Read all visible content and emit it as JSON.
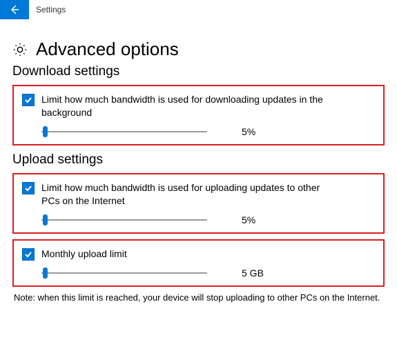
{
  "titlebar": {
    "label": "Settings"
  },
  "page": {
    "title": "Advanced options"
  },
  "download": {
    "section_title": "Download settings",
    "limit_label": "Limit how much bandwidth is used for downloading updates in the background",
    "limit_checked": true,
    "slider_value": "5%"
  },
  "upload": {
    "section_title": "Upload settings",
    "limit_label": "Limit how much bandwidth is used for uploading updates to other PCs on the Internet",
    "limit_checked": true,
    "slider_value": "5%",
    "monthly_limit_label": "Monthly upload limit",
    "monthly_limit_checked": true,
    "monthly_slider_value": "5 GB",
    "note": "Note: when this limit is reached, your device will stop uploading to other PCs on the Internet."
  }
}
